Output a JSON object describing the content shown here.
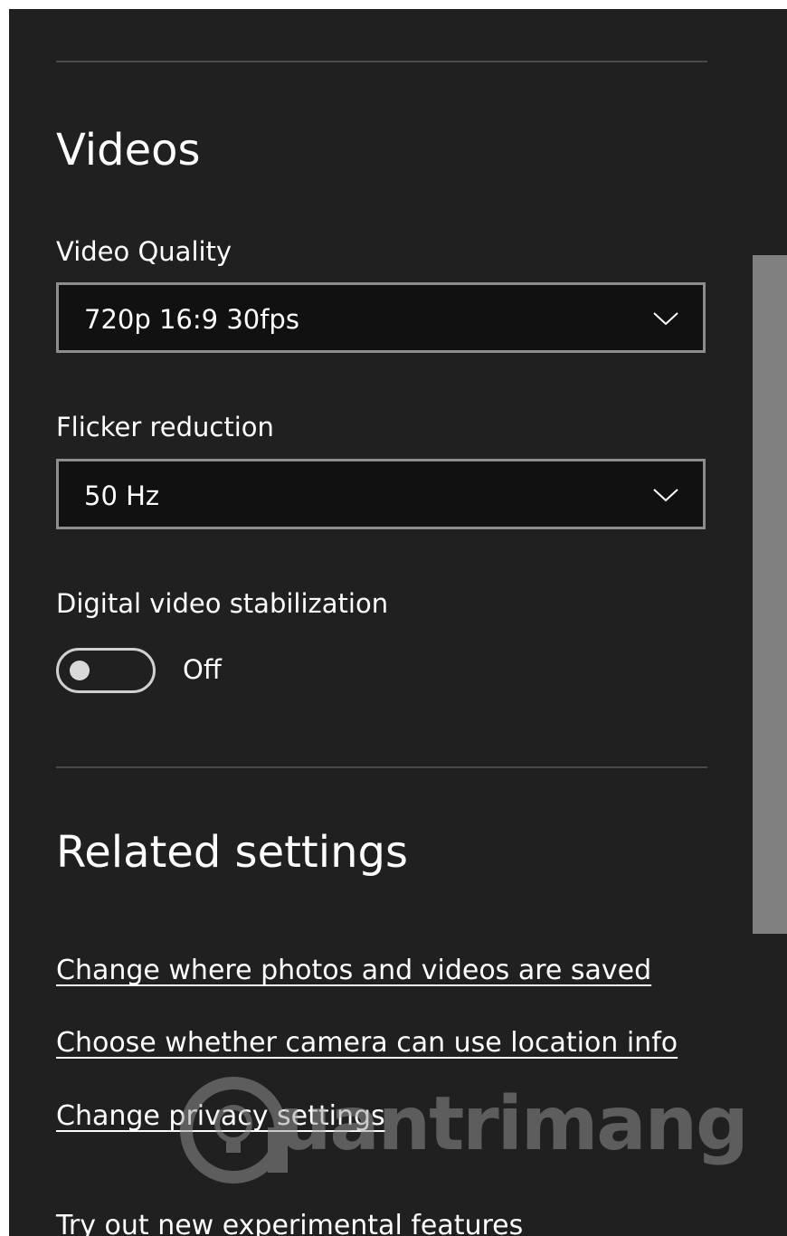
{
  "videos_section": {
    "title": "Videos",
    "video_quality": {
      "label": "Video Quality",
      "selected": "720p 16:9 30fps",
      "icon": "chevron-down-icon"
    },
    "flicker_reduction": {
      "label": "Flicker reduction",
      "selected": "50 Hz",
      "icon": "chevron-down-icon"
    },
    "stabilization": {
      "label": "Digital video stabilization",
      "state": "Off",
      "on": false
    }
  },
  "related_section": {
    "title": "Related settings",
    "links": [
      "Change where photos and videos are saved",
      "Choose whether camera can use location info",
      "Change privacy settings",
      "Try out new experimental features"
    ]
  },
  "watermark": {
    "text": "uantrimang"
  },
  "colors": {
    "background": "#202020",
    "text": "#ffffff",
    "select_border": "#8d8d8d",
    "scrollbar_thumb": "#808080"
  }
}
